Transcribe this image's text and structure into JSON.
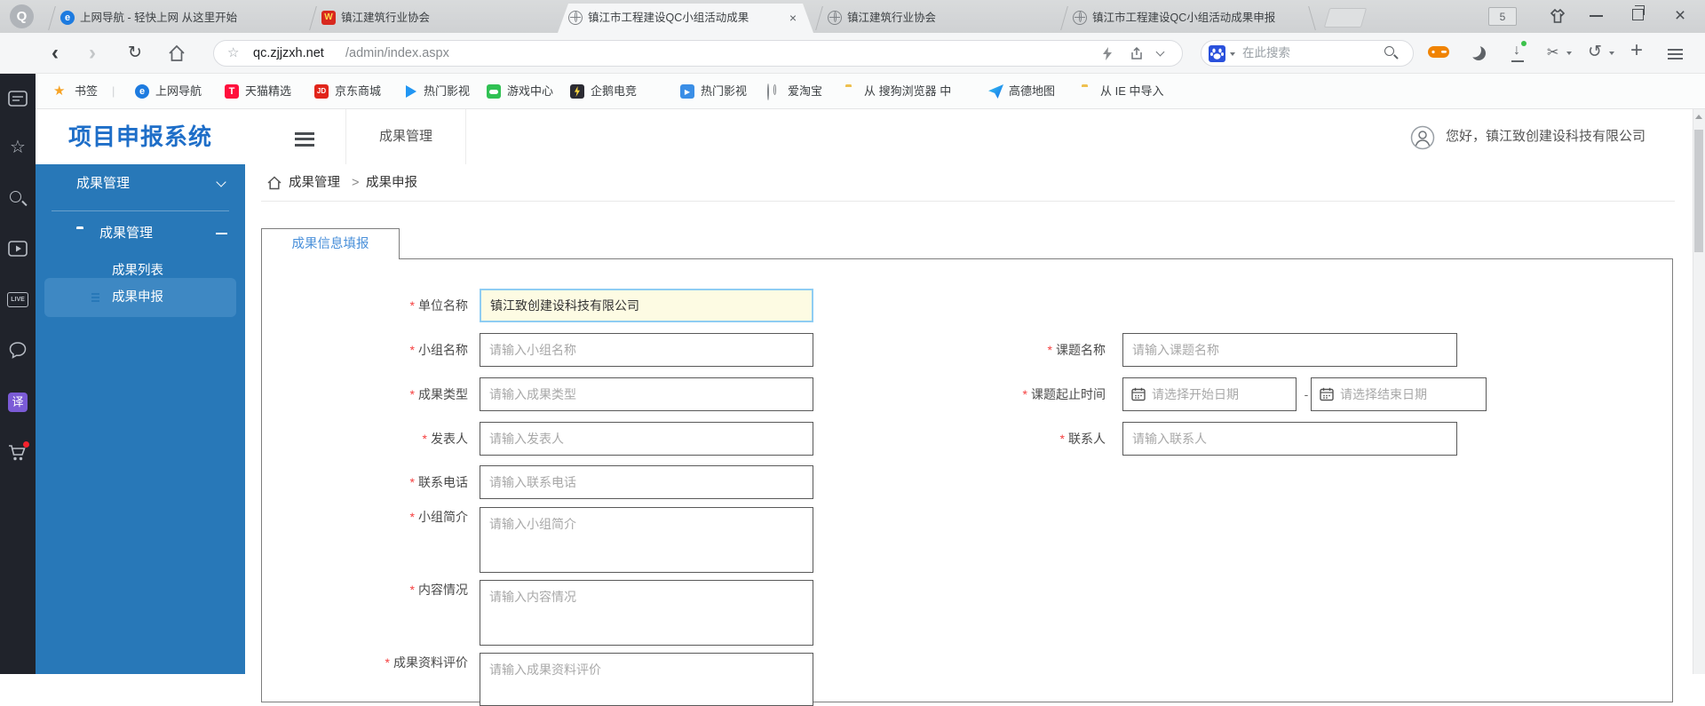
{
  "browser": {
    "logo_text": "Q",
    "tabs": [
      {
        "title": "上网导航 - 轻快上网 从这里开始",
        "favicon": "e-navigation",
        "favicon_text": "e",
        "active": false
      },
      {
        "title": "镇江建筑行业协会",
        "favicon": "association-logo",
        "favicon_text": "W",
        "active": false
      },
      {
        "title": "镇江市工程建设QC小组活动成果",
        "favicon": "globe",
        "active": true
      },
      {
        "title": "镇江建筑行业协会",
        "favicon": "globe",
        "active": false
      },
      {
        "title": "镇江市工程建设QC小组活动成果申报",
        "favicon": "globe",
        "active": false
      }
    ],
    "tab_count_badge": "5",
    "window_controls": {
      "close_glyph": "×"
    },
    "nav": {
      "back": "‹",
      "forward": "›",
      "refresh": "↻"
    },
    "address": {
      "host": "qc.zjjzxh.net",
      "path": "/admin/index.aspx",
      "star": "☆"
    },
    "search": {
      "placeholder": "在此搜索"
    },
    "toolbar_glyphs": {
      "download_arrow": "↓",
      "scissors": "✂",
      "undo": "↺",
      "plus": "+"
    },
    "bookmarks": {
      "star": "★",
      "label": "书签",
      "divider": "|",
      "items": [
        {
          "text": "上网导航",
          "icon": "nav-blue-circle",
          "icon_text": "e"
        },
        {
          "text": "天猫精选",
          "icon": "tmall-red",
          "icon_text": "T"
        },
        {
          "text": "京东商城",
          "icon": "jd-red",
          "icon_text": "JD"
        },
        {
          "text": "热门影视",
          "icon": "play-blue"
        },
        {
          "text": "游戏中心",
          "icon": "game-green"
        },
        {
          "text": "企鹅电竞",
          "icon": "penguin-dark"
        },
        {
          "text": "热门影视",
          "icon": "video-blue",
          "icon_text": "▶"
        },
        {
          "text": "爱淘宝",
          "icon": "globe"
        },
        {
          "text": "从 搜狗浏览器 中",
          "icon": "folder"
        },
        {
          "text": "高德地图",
          "icon": "amap-plane"
        },
        {
          "text": "从 IE 中导入",
          "icon": "folder"
        }
      ]
    },
    "side_strip": {
      "live_label": "LIVE",
      "translate_label": "译",
      "star_outline": "☆"
    }
  },
  "app": {
    "title": "项目申报系统",
    "top_menu": "成果管理",
    "user_greeting": "您好，镇江致创建设科技有限公司",
    "sidebar": {
      "root": "成果管理",
      "group": "成果管理",
      "items": [
        {
          "label": "成果列表",
          "selected": false
        },
        {
          "label": "成果申报",
          "selected": true
        }
      ]
    },
    "breadcrumb": {
      "items": [
        "成果管理",
        "成果申报"
      ],
      "separator": ">"
    },
    "form": {
      "tab": "成果信息填报",
      "required_mark": "*",
      "left": [
        {
          "label": "单位名称",
          "value": "镇江致创建设科技有限公司",
          "state": "focused"
        },
        {
          "label": "小组名称",
          "placeholder": "请输入小组名称"
        },
        {
          "label": "成果类型",
          "placeholder": "请输入成果类型"
        },
        {
          "label": "发表人",
          "placeholder": "请输入发表人"
        },
        {
          "label": "联系电话",
          "placeholder": "请输入联系电话"
        },
        {
          "label": "小组简介",
          "placeholder": "请输入小组简介"
        },
        {
          "label": "内容情况",
          "placeholder": "请输入内容情况"
        },
        {
          "label": "成果资料评价",
          "placeholder": "请输入成果资料评价"
        }
      ],
      "right": [
        {
          "label": "课题名称",
          "placeholder": "请输入课题名称"
        },
        {
          "label": "课题起止时间",
          "start_placeholder": "请选择开始日期",
          "end_placeholder": "请选择结束日期",
          "separator": "-"
        },
        {
          "label": "联系人",
          "placeholder": "请输入联系人"
        }
      ]
    },
    "colors": {
      "sidebar_blue": "#2878b8",
      "sidebar_selected": "#3e88c3",
      "title_blue": "#1e6ec8",
      "tab_link_blue": "#4a90da",
      "focused_bg": "#fdfbe3",
      "focused_border": "#8fcdf3",
      "required_red": "#f53f3f"
    }
  }
}
